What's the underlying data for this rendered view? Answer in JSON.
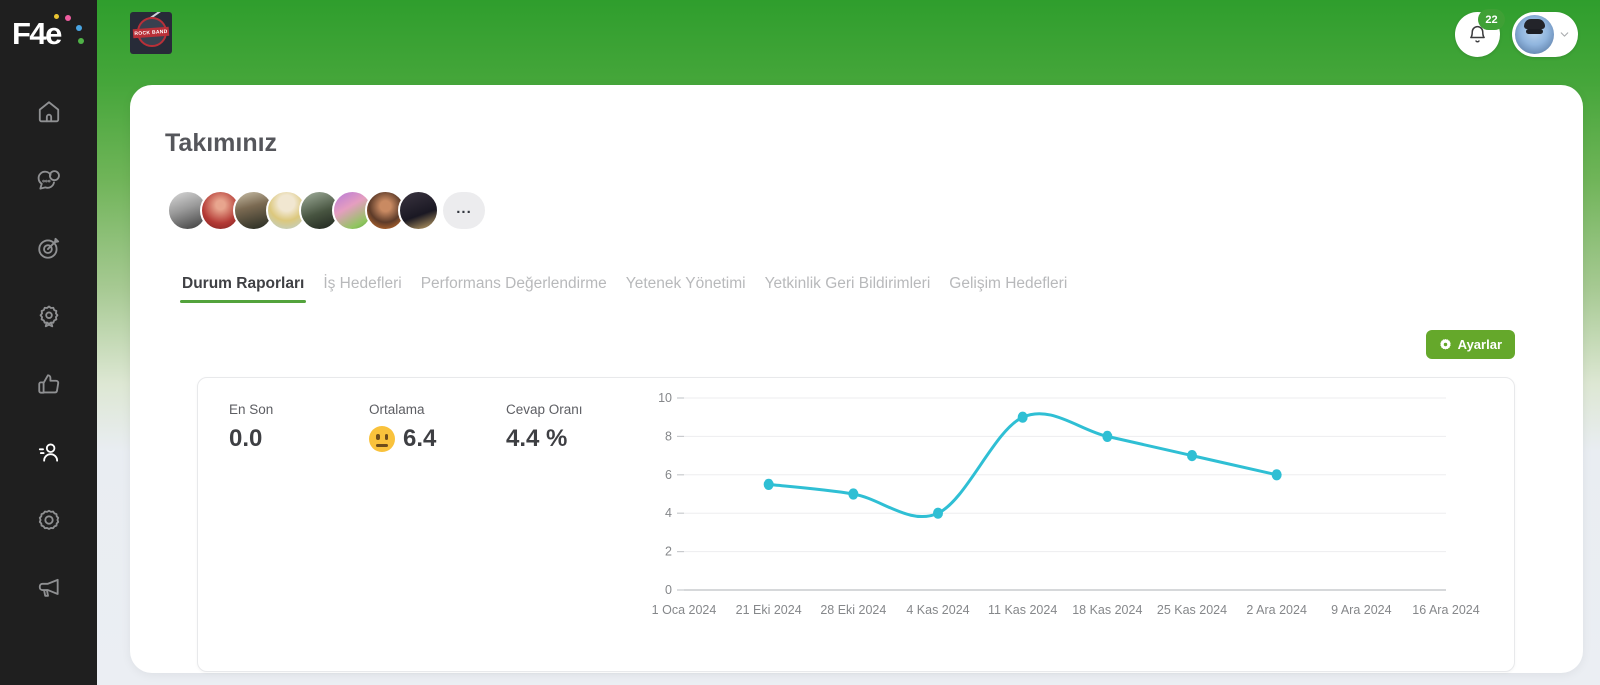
{
  "brand": {
    "logo_text": "F4e"
  },
  "sidebar": {
    "items": [
      {
        "icon": "home-icon",
        "active": false
      },
      {
        "icon": "chat-icon",
        "active": false
      },
      {
        "icon": "target-icon",
        "active": false
      },
      {
        "icon": "medal-icon",
        "active": false
      },
      {
        "icon": "thumbs-up-icon",
        "active": false
      },
      {
        "icon": "team-member-icon",
        "active": true
      },
      {
        "icon": "gear-icon",
        "active": false
      },
      {
        "icon": "megaphone-icon",
        "active": false
      }
    ]
  },
  "topbar": {
    "company_logo_label": "ROCK BAND",
    "notification_count": "22"
  },
  "page": {
    "title": "Takımınız"
  },
  "team": {
    "member_count": 8,
    "overflow_label": "..."
  },
  "tabs": [
    {
      "label": "Durum Raporları",
      "active": true
    },
    {
      "label": "İş Hedefleri",
      "active": false
    },
    {
      "label": "Performans Değerlendirme",
      "active": false
    },
    {
      "label": "Yetenek Yönetimi",
      "active": false
    },
    {
      "label": "Yetkinlik Geri Bildirimleri",
      "active": false
    },
    {
      "label": "Gelişim Hedefleri",
      "active": false
    }
  ],
  "settings_button": {
    "label": "Ayarlar"
  },
  "stats": [
    {
      "label": "En Son",
      "value": "0.0"
    },
    {
      "label": "Ortalama",
      "value": "6.4",
      "emoji": "neutral-face-emoji"
    },
    {
      "label": "Cevap Oranı",
      "value": "4.4 %"
    }
  ],
  "chart_data": {
    "type": "line",
    "categories": [
      "1 Oca 2024",
      "21 Eki 2024",
      "28 Eki 2024",
      "4 Kas 2024",
      "11 Kas 2024",
      "18 Kas 2024",
      "25 Kas 2024",
      "2 Ara 2024",
      "9 Ara 2024",
      "16 Ara 2024"
    ],
    "series": [
      {
        "name": "Durum Raporları",
        "values": [
          null,
          5.5,
          5,
          4,
          9,
          8,
          7,
          6,
          null,
          null
        ]
      }
    ],
    "title": "",
    "xlabel": "",
    "ylabel": "",
    "ylim": [
      0,
      10
    ],
    "yticks": [
      0,
      2,
      4,
      6,
      8,
      10
    ],
    "grid": true,
    "smooth": true,
    "markers": true,
    "legend": "none",
    "line_color": "#2fbfd4",
    "grid_color": "#ededef",
    "axis_color": "#c9cbce",
    "tick_text_color": "#85878a"
  },
  "colors": {
    "accent_green": "#53a33c",
    "button_green": "#65a82b",
    "badge_green": "#3fa035",
    "sidebar_bg": "#1f1f1f"
  }
}
